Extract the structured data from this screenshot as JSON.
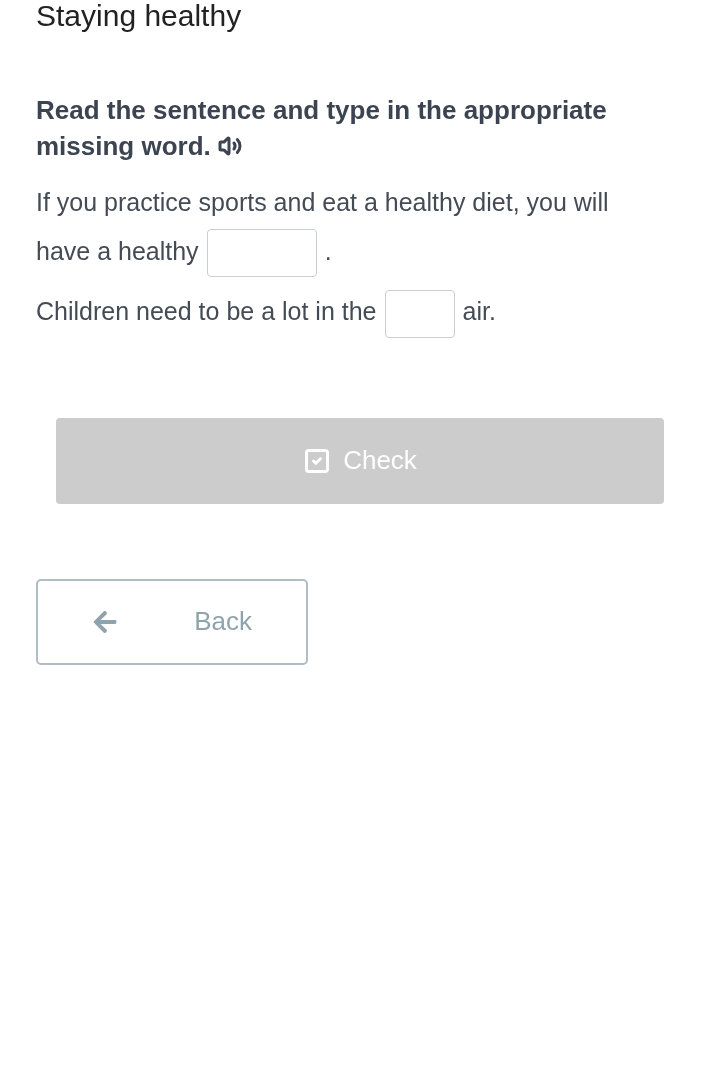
{
  "title": "Staying healthy",
  "instruction": "Read the sentence and type in the appropriate missing word.",
  "sentences": [
    {
      "parts": [
        {
          "kind": "line",
          "text": "If you practice sports and eat a healthy diet, you will"
        },
        {
          "kind": "text",
          "text": "have a healthy"
        },
        {
          "kind": "blank"
        },
        {
          "kind": "text",
          "text": "."
        }
      ]
    },
    {
      "parts": [
        {
          "kind": "text",
          "text": "Children need to be a lot in the"
        },
        {
          "kind": "blank"
        },
        {
          "kind": "text",
          "text": "air."
        }
      ]
    }
  ],
  "check_button": {
    "label": "Check",
    "disabled": true
  },
  "back_button": {
    "label": "Back"
  }
}
